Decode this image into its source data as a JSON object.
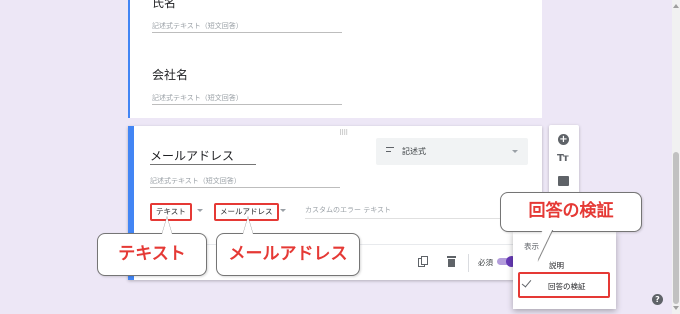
{
  "form": {
    "q1": {
      "title": "氏名",
      "hint": "記述式テキスト（短文回答）"
    },
    "q2": {
      "title": "会社名",
      "hint": "記述式テキスト（短文回答）"
    },
    "q3": {
      "title": "メールアドレス",
      "hint": "記述式テキスト（短文回答）",
      "type_label": "記述式",
      "validation_type": "テキスト",
      "validation_rule": "メールアドレス",
      "error_placeholder": "カスタムのエラー テキスト"
    },
    "footer": {
      "required_label": "必須",
      "required_on": true
    }
  },
  "menu": {
    "header": "表示",
    "items": [
      {
        "label": "説明",
        "checked": false
      },
      {
        "label": "回答の検証",
        "checked": true
      }
    ]
  },
  "callouts": {
    "validation_menu": "回答の検証",
    "text_type": "テキスト",
    "email_rule": "メールアドレス"
  },
  "icons": {
    "add_question": "add-circle-icon",
    "add_title": "title-text-icon",
    "add_image": "image-icon",
    "duplicate": "copy-icon",
    "delete": "trash-icon",
    "help": "help-icon"
  },
  "colors": {
    "background": "#ede7f6",
    "accent_blue": "#4285f4",
    "toggle": "#673ab7",
    "highlight_red": "#e53935"
  }
}
